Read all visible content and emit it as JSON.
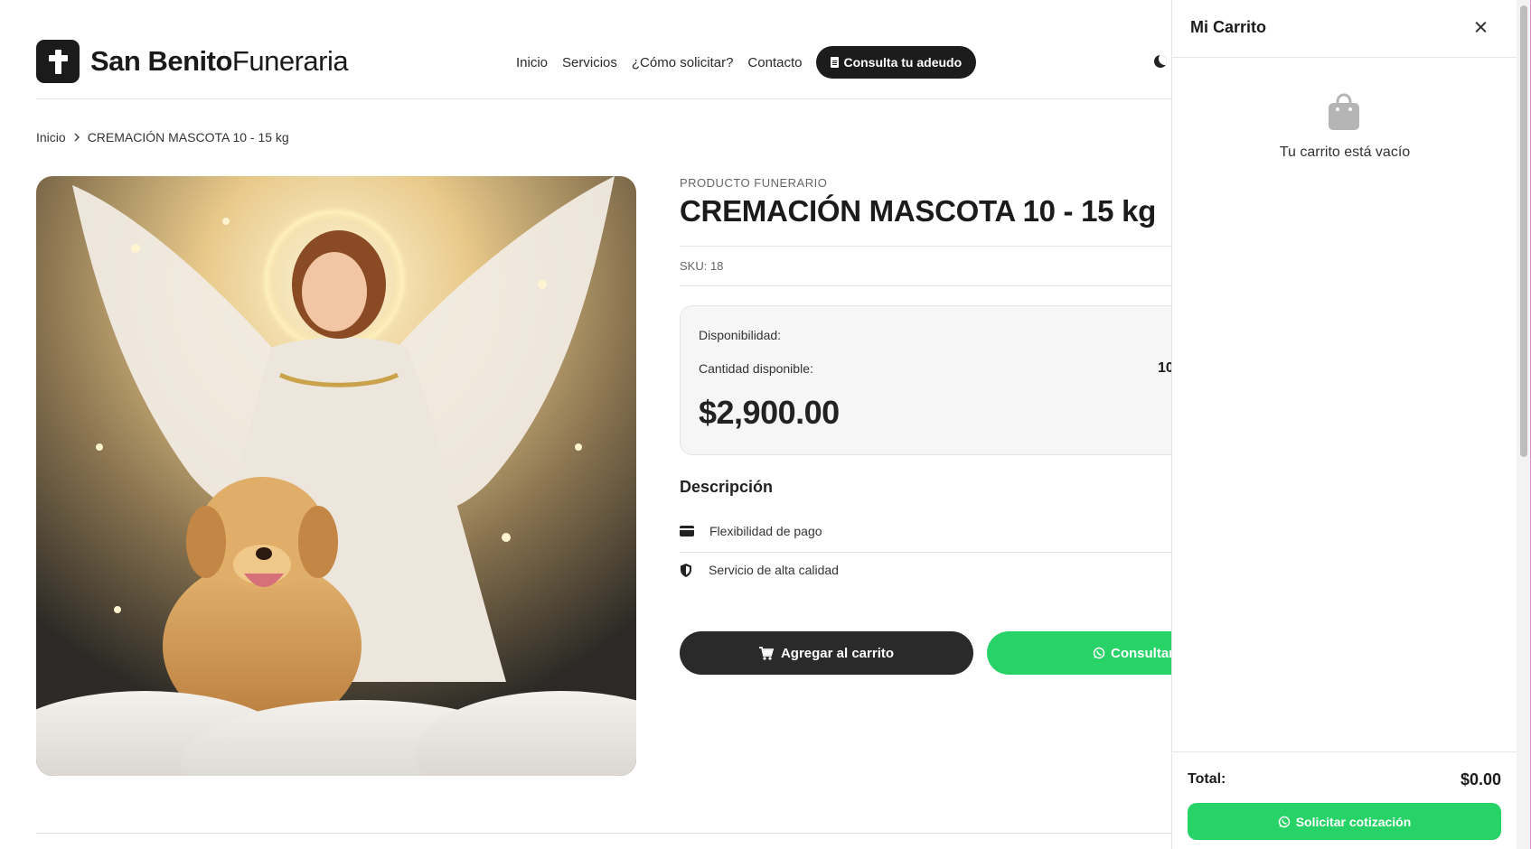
{
  "header": {
    "brand_bold": "San Benito",
    "brand_light": "Funeraria",
    "nav": [
      "Inicio",
      "Servicios",
      "¿Cómo solicitar?",
      "Contacto"
    ],
    "cta_label": "Consulta tu adeudo"
  },
  "breadcrumb": {
    "home": "Inicio",
    "current": "CREMACIÓN MASCOTA 10 - 15 kg"
  },
  "product": {
    "overline": "PRODUCTO FUNERARIO",
    "title": "CREMACIÓN MASCOTA 10 - 15 kg",
    "sku": "SKU: 18",
    "availability_label": "Disponibilidad:",
    "quantity_label": "Cantidad disponible:",
    "quantity_value": "10",
    "price": "$2,900.00",
    "description_title": "Descripción",
    "features": [
      "Flexibilidad de pago",
      "Servicio de alta calidad"
    ],
    "add_to_cart_label": "Agregar al carrito",
    "consult_label": "Consultar"
  },
  "cart": {
    "title": "Mi Carrito",
    "empty_text": "Tu carrito está vacío",
    "total_label": "Total:",
    "total_value": "$0.00",
    "quote_label": "Solicitar cotización"
  },
  "colors": {
    "dark": "#1c1c1c",
    "whatsapp_green": "#27d366",
    "panel_bg": "#f6f6f6"
  },
  "icons": [
    "cross-icon",
    "document-icon",
    "moon-icon",
    "chevron-right-icon",
    "credit-card-icon",
    "shield-icon",
    "cart-icon",
    "whatsapp-icon",
    "close-icon",
    "shopping-bag-icon"
  ]
}
